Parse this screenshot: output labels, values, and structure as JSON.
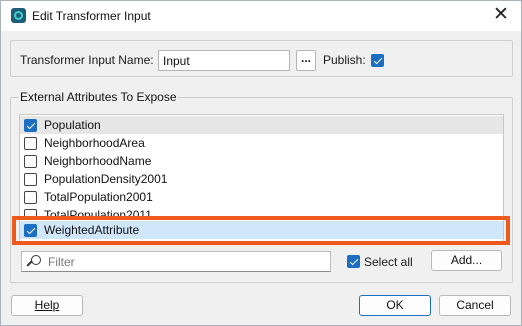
{
  "window": {
    "title": "Edit Transformer Input",
    "close_glyph": "✕"
  },
  "input_group": {
    "name_label": "Transformer Input Name:",
    "name_value": "Input",
    "browse_label": "...",
    "publish_label": "Publish:",
    "publish_checked": true
  },
  "attributes_group": {
    "label": "External Attributes To Expose",
    "items": [
      {
        "label": "Population",
        "checked": true
      },
      {
        "label": "NeighborhoodArea",
        "checked": false
      },
      {
        "label": "NeighborhoodName",
        "checked": false
      },
      {
        "label": "PopulationDensity2001",
        "checked": false
      },
      {
        "label": "TotalPopulation2001",
        "checked": false
      },
      {
        "label": "TotalPopulation2011",
        "checked": false
      },
      {
        "label": "WeightedAttribute",
        "checked": true
      }
    ],
    "filter_placeholder": "Filter",
    "select_all_label": "Select all",
    "select_all_checked": true,
    "add_label": "Add..."
  },
  "footer": {
    "help_label": "Help",
    "ok_label": "OK",
    "cancel_label": "Cancel"
  },
  "colors": {
    "accent": "#1b6ec2",
    "highlight_outline": "#ec5a1d",
    "selected_row": "#cfe6fb"
  }
}
